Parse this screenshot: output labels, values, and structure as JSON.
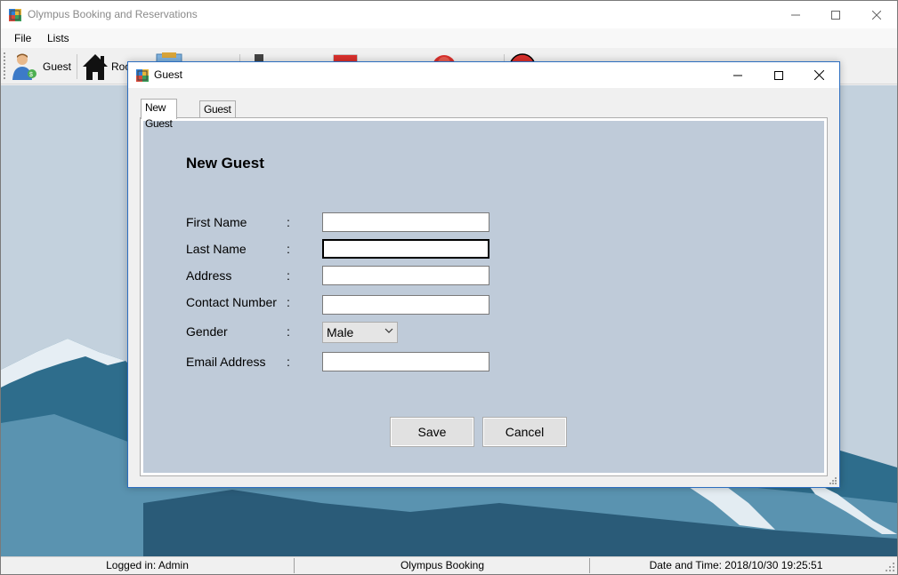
{
  "main": {
    "title": "Olympus Booking and Reservations",
    "menu": [
      "File",
      "Lists"
    ],
    "toolbar": [
      {
        "label": "Guest",
        "icon": "guest-icon"
      },
      {
        "label": "Roo",
        "icon": "home-icon"
      },
      {
        "label": "",
        "icon": "booking-icon"
      },
      {
        "label": "",
        "icon": "door-icon"
      },
      {
        "label": "",
        "icon": "calendar-icon"
      },
      {
        "label": "",
        "icon": "red-circle-icon"
      },
      {
        "label": "",
        "icon": "exit-icon"
      }
    ]
  },
  "dialog": {
    "title": "Guest",
    "tabs": [
      "New Guest",
      "Guest List"
    ],
    "heading": "New Guest",
    "fields": {
      "first_name": {
        "label": "First Name",
        "value": ""
      },
      "last_name": {
        "label": "Last Name",
        "value": ""
      },
      "address": {
        "label": "Address",
        "value": ""
      },
      "contact": {
        "label": "Contact Number",
        "value": ""
      },
      "gender": {
        "label": "Gender",
        "value": "Male"
      },
      "email": {
        "label": "Email Address",
        "value": ""
      }
    },
    "colon": ":",
    "save_label": "Save",
    "cancel_label": "Cancel"
  },
  "status": {
    "logged_in": "Logged in: Admin",
    "app": "Olympus Booking",
    "datetime": "Date and Time: 2018/10/30 19:25:51"
  },
  "colors": {
    "form_bg": "#bfcbd9",
    "desktop_sky": "#c3d1dd",
    "mountain_dark": "#2e6d8c",
    "dialog_border": "#2d6ec0"
  }
}
